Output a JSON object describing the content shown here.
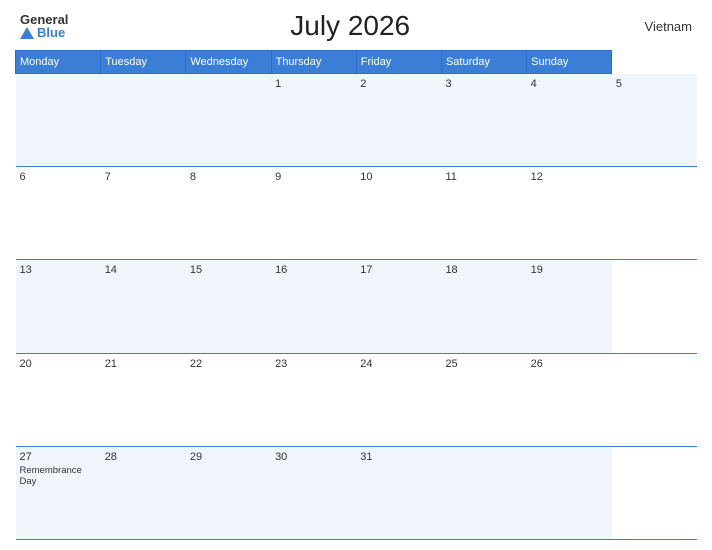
{
  "header": {
    "logo_general": "General",
    "logo_blue": "Blue",
    "title": "July 2026",
    "country": "Vietnam"
  },
  "calendar": {
    "days_of_week": [
      "Monday",
      "Tuesday",
      "Wednesday",
      "Thursday",
      "Friday",
      "Saturday",
      "Sunday"
    ],
    "weeks": [
      [
        {
          "day": "",
          "event": ""
        },
        {
          "day": "",
          "event": ""
        },
        {
          "day": "",
          "event": ""
        },
        {
          "day": "1",
          "event": ""
        },
        {
          "day": "2",
          "event": ""
        },
        {
          "day": "3",
          "event": ""
        },
        {
          "day": "4",
          "event": ""
        },
        {
          "day": "5",
          "event": ""
        }
      ],
      [
        {
          "day": "6",
          "event": ""
        },
        {
          "day": "7",
          "event": ""
        },
        {
          "day": "8",
          "event": ""
        },
        {
          "day": "9",
          "event": ""
        },
        {
          "day": "10",
          "event": ""
        },
        {
          "day": "11",
          "event": ""
        },
        {
          "day": "12",
          "event": ""
        }
      ],
      [
        {
          "day": "13",
          "event": ""
        },
        {
          "day": "14",
          "event": ""
        },
        {
          "day": "15",
          "event": ""
        },
        {
          "day": "16",
          "event": ""
        },
        {
          "day": "17",
          "event": ""
        },
        {
          "day": "18",
          "event": ""
        },
        {
          "day": "19",
          "event": ""
        }
      ],
      [
        {
          "day": "20",
          "event": ""
        },
        {
          "day": "21",
          "event": ""
        },
        {
          "day": "22",
          "event": ""
        },
        {
          "day": "23",
          "event": ""
        },
        {
          "day": "24",
          "event": ""
        },
        {
          "day": "25",
          "event": ""
        },
        {
          "day": "26",
          "event": ""
        }
      ],
      [
        {
          "day": "27",
          "event": "Remembrance Day"
        },
        {
          "day": "28",
          "event": ""
        },
        {
          "day": "29",
          "event": ""
        },
        {
          "day": "30",
          "event": ""
        },
        {
          "day": "31",
          "event": ""
        },
        {
          "day": "",
          "event": ""
        },
        {
          "day": "",
          "event": ""
        }
      ]
    ]
  }
}
